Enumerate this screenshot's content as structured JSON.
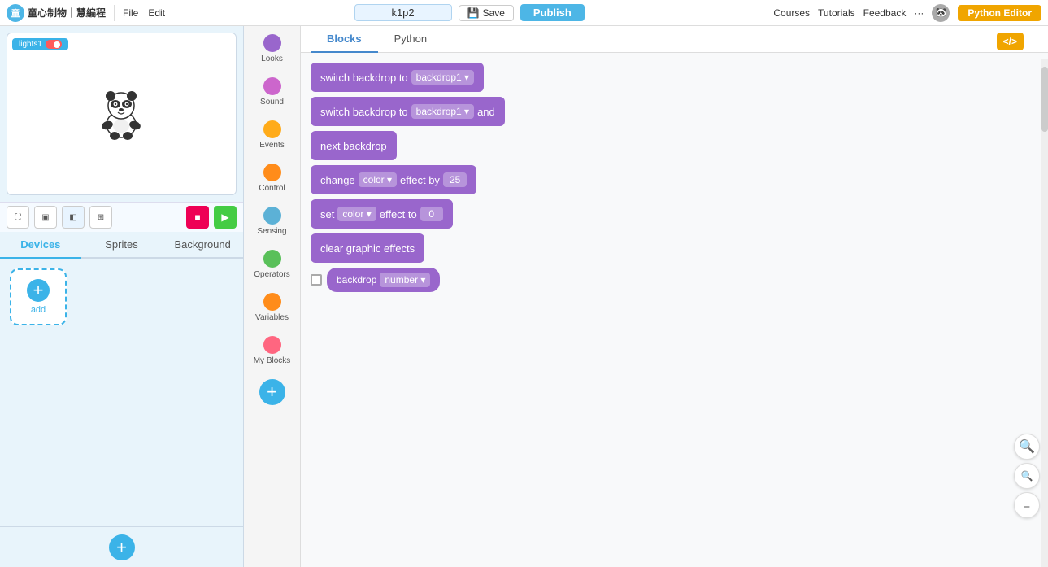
{
  "topnav": {
    "brand": "童心制物｜慧編程",
    "file": "File",
    "edit": "Edit",
    "project_name": "k1p2",
    "save": "Save",
    "publish": "Publish",
    "courses": "Courses",
    "tutorials": "Tutorials",
    "feedback": "Feedback",
    "python_editor": "Python Editor"
  },
  "stage": {
    "label": "lights1",
    "toggle": "on"
  },
  "controls": {
    "expand": "⛶",
    "layout1": "▣",
    "layout2": "◧",
    "layout3": "⊞",
    "stop": "■",
    "go": "▶"
  },
  "tabs": {
    "devices": "Devices",
    "sprites": "Sprites",
    "background": "Background"
  },
  "add_device": "add",
  "categories": [
    {
      "id": "looks",
      "label": "Looks",
      "color": "#9966cc"
    },
    {
      "id": "sound",
      "label": "Sound",
      "color": "#cc66cc"
    },
    {
      "id": "events",
      "label": "Events",
      "color": "#ffab19"
    },
    {
      "id": "control",
      "label": "Control",
      "color": "#ff8c1a"
    },
    {
      "id": "sensing",
      "label": "Sensing",
      "color": "#5cb1d6"
    },
    {
      "id": "operators",
      "label": "Operators",
      "color": "#59c059"
    },
    {
      "id": "variables",
      "label": "Variables",
      "color": "#ff8c1a"
    },
    {
      "id": "myblocks",
      "label": "My Blocks",
      "color": "#ff6680"
    }
  ],
  "blocks_tabs": {
    "blocks": "Blocks",
    "python": "Python"
  },
  "blocks": [
    {
      "id": "switch-backdrop-1",
      "type": "command",
      "text_parts": [
        "switch backdrop to",
        "backdrop1"
      ],
      "has_dropdown": true
    },
    {
      "id": "switch-backdrop-and",
      "type": "command",
      "text_parts": [
        "switch backdrop to",
        "backdrop1",
        "and"
      ],
      "has_dropdown": true
    },
    {
      "id": "next-backdrop",
      "type": "command",
      "text_parts": [
        "next backdrop"
      ],
      "has_dropdown": false
    },
    {
      "id": "change-color-effect",
      "type": "command",
      "text_parts": [
        "change",
        "color",
        "effect by",
        "25"
      ],
      "has_dropdown": true,
      "value": "25"
    },
    {
      "id": "set-color-effect",
      "type": "command",
      "text_parts": [
        "set",
        "color",
        "effect to",
        "0"
      ],
      "has_dropdown": true,
      "value": "0"
    },
    {
      "id": "clear-graphic-effects",
      "type": "command",
      "text_parts": [
        "clear graphic effects"
      ],
      "has_dropdown": false
    },
    {
      "id": "backdrop-number",
      "type": "reporter",
      "text_parts": [
        "backdrop",
        "number"
      ],
      "has_checkbox": true,
      "has_dropdown": true
    }
  ],
  "xml_label": "</>",
  "zoom_in": "+",
  "zoom_out": "−",
  "zoom_reset": "="
}
